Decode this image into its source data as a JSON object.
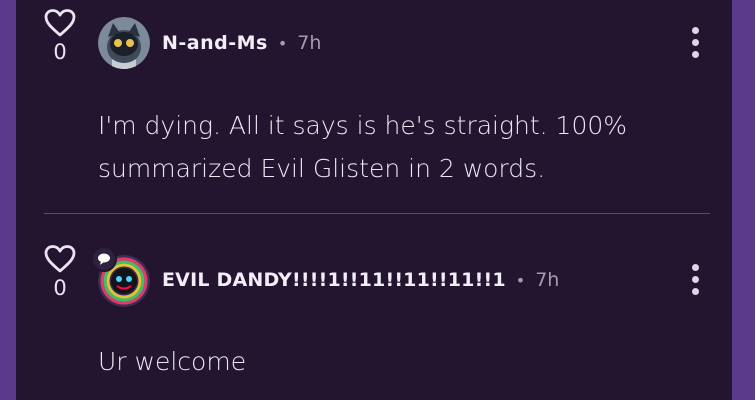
{
  "comments": [
    {
      "like_count": "0",
      "username": "N-and-Ms",
      "separator": "•",
      "time": "7h",
      "text": "I'm dying. All it says is he's straight. 100% summarized Evil Glisten in 2 words."
    },
    {
      "like_count": "0",
      "username": "EVIL DANDY!!!!1!!11!!11!!11!!1",
      "separator": "•",
      "time": "7h",
      "text": "Ur welcome"
    }
  ],
  "colors": {
    "background": "#231530",
    "outer": "#5b3a8c",
    "text": "#ece8f2",
    "muted": "#a49bb0"
  },
  "icons": [
    "heart-icon",
    "more-options-icon",
    "chat-bubble-icon"
  ]
}
